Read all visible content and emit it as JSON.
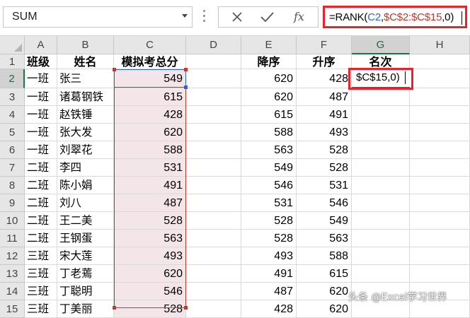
{
  "namebox": {
    "value": "SUM"
  },
  "formula_bar": {
    "icons": [
      "cancel-icon",
      "enter-check-icon",
      "insert-function-icon"
    ],
    "fx_label": "fx",
    "formula": {
      "prefix": "=RANK(",
      "ref1": "C2",
      "sep1": ",",
      "ref2": "$C$2:$C$15",
      "suffix": ",0)"
    },
    "ref1_color": "#2e66c7",
    "ref2_color": "#c0392b"
  },
  "columns": [
    "A",
    "B",
    "C",
    "D",
    "E",
    "F",
    "G",
    "H"
  ],
  "selected_column": "G",
  "selected_row": "2",
  "row_numbers": [
    "1",
    "2",
    "3",
    "4",
    "5",
    "6",
    "7",
    "8",
    "9",
    "10",
    "11",
    "12",
    "13",
    "14",
    "15"
  ],
  "headers": {
    "A": "班级",
    "B": "姓名",
    "C": "模拟考总分",
    "E": "降序",
    "F": "升序",
    "G": "名次"
  },
  "rows": [
    {
      "class": "一班",
      "name": "张三",
      "score": "549",
      "desc": "620",
      "asc": "428"
    },
    {
      "class": "一班",
      "name": "诸葛钢铁",
      "score": "615",
      "desc": "620",
      "asc": "487"
    },
    {
      "class": "一班",
      "name": "赵铁锤",
      "score": "428",
      "desc": "615",
      "asc": "491"
    },
    {
      "class": "一班",
      "name": "张大发",
      "score": "620",
      "desc": "588",
      "asc": "493"
    },
    {
      "class": "一班",
      "name": "刘翠花",
      "score": "588",
      "desc": "563",
      "asc": "528"
    },
    {
      "class": "二班",
      "name": "李四",
      "score": "531",
      "desc": "549",
      "asc": "528"
    },
    {
      "class": "二班",
      "name": "陈小娟",
      "score": "491",
      "desc": "546",
      "asc": "531"
    },
    {
      "class": "二班",
      "name": "刘八",
      "score": "487",
      "desc": "531",
      "asc": "546"
    },
    {
      "class": "二班",
      "name": "王二美",
      "score": "528",
      "desc": "528",
      "asc": "549"
    },
    {
      "class": "二班",
      "name": "王钢蛋",
      "score": "563",
      "desc": "528",
      "asc": "563"
    },
    {
      "class": "三班",
      "name": "宋大莲",
      "score": "493",
      "desc": "493",
      "asc": "588"
    },
    {
      "class": "三班",
      "name": "丁老蔫",
      "score": "620",
      "desc": "491",
      "asc": "615"
    },
    {
      "class": "三班",
      "name": "丁聪明",
      "score": "546",
      "desc": "487",
      "asc": "620"
    },
    {
      "class": "三班",
      "name": "丁美丽",
      "score": "528",
      "desc": "428",
      "asc": "620"
    }
  ],
  "active_cell": {
    "address": "G2",
    "visible_text": "$C$15,0)"
  },
  "watermark": {
    "text": "头条 @Excel学习世界"
  }
}
